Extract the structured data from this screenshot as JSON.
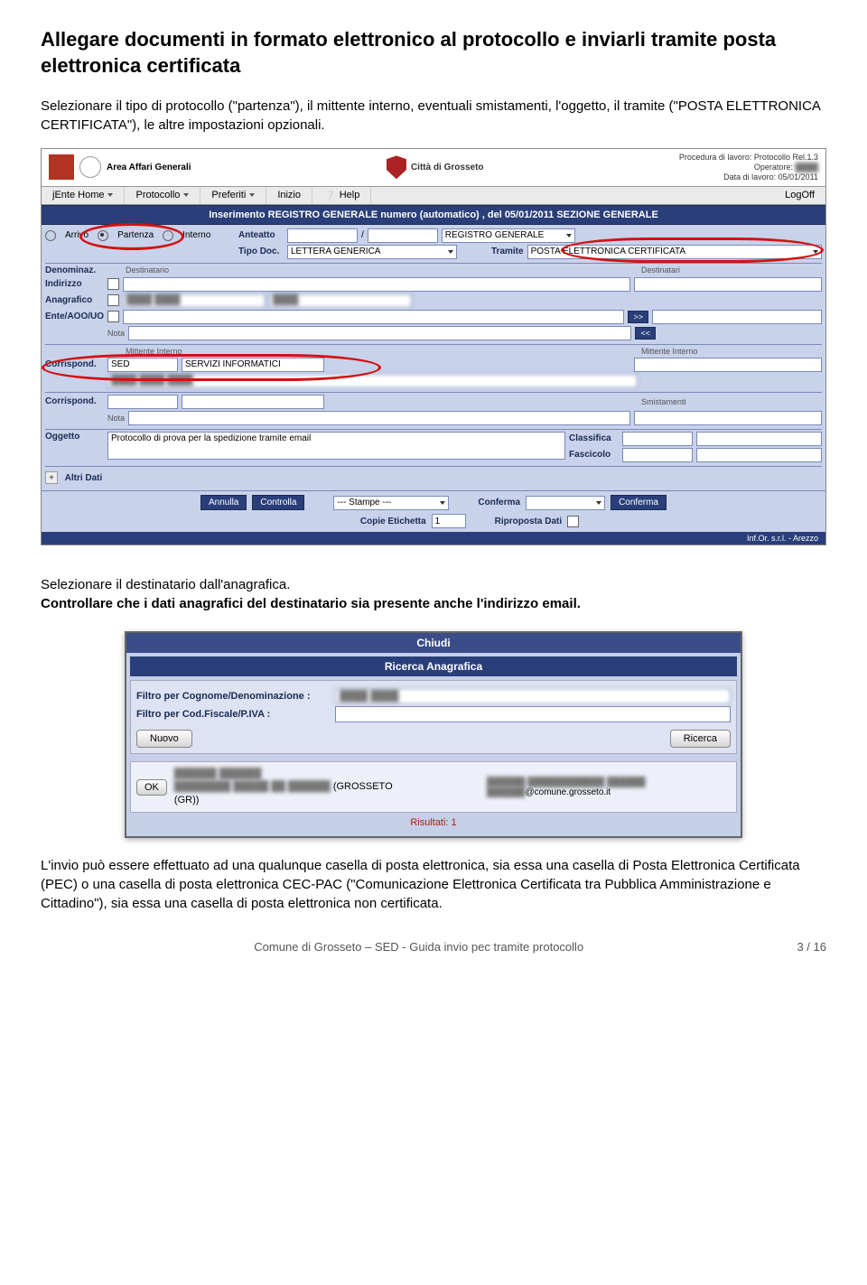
{
  "title": "Allegare documenti in formato elettronico al protocollo e inviarli tramite posta elettronica certificata",
  "para1": "Selezionare il tipo di protocollo (\"partenza\"), il mittente interno, eventuali smistamenti, l'oggetto, il tramite (\"POSTA ELETTRONICA CERTIFICATA\"), le altre impostazioni opzionali.",
  "para2a": "Selezionare il destinatario dall'anagrafica.",
  "para2b": "Controllare che  i dati anagrafici del destinatario sia presente anche l'indirizzo email.",
  "para3": "L'invio può essere effettuato ad una qualunque casella di posta elettronica, sia essa una casella di Posta Elettronica Certificata (PEC) o una casella di posta elettronica CEC-PAC (\"Comunicazione Elettronica Certificata tra Pubblica Amministrazione e Cittadino\"), sia essa una casella di posta elettronica non certificata.",
  "app": {
    "area": "Area Affari Generali",
    "city": "Città di Grosseto",
    "proc1": "Procedura di lavoro: Protocollo Rel.1.3",
    "proc2": "Operatore:",
    "proc3": "Data di lavoro: 05/01/2011"
  },
  "menu": {
    "home": "jEnte Home",
    "protocollo": "Protocollo",
    "preferiti": "Preferiti",
    "inizio": "Inizio",
    "help": "Help",
    "logoff": "LogOff"
  },
  "bluebar": "Inserimento REGISTRO GENERALE numero (automatico) , del 05/01/2011 SEZIONE GENERALE",
  "form": {
    "arrivo": "Arrivo",
    "partenza": "Partenza",
    "interno": "Interno",
    "anteatto": "Anteatto",
    "sep": "/",
    "registro": "REGISTRO GENERALE",
    "tipodoc": "Tipo Doc.",
    "tipodoc_val": "LETTERA GENERICA",
    "tramite": "Tramite",
    "tramite_val": "POSTA ELETTRONICA CERTIFICATA",
    "denominaz": "Denominaz.",
    "destinatario": "Destinatario",
    "destinatari": "Destinatari",
    "indirizzo": "Indirizzo",
    "anagrafico": "Anagrafico",
    "ente": "Ente/AOO/UO",
    "nota": "Nota",
    "mittente": "Mittente Interno",
    "corrispond": "Corrispond.",
    "sed": "SED",
    "servizi": "SERVIZI INFORMATICI",
    "smistamenti": "Smistamenti",
    "oggetto": "Oggetto",
    "oggetto_val": "Protocollo di prova per la spedizione tramite email",
    "classifica": "Classifica",
    "fascicolo": "Fascicolo",
    "altridati": "Altri Dati"
  },
  "actions": {
    "annulla": "Annulla",
    "controlla": "Controlla",
    "stampe": "--- Stampe ---",
    "copie": "Copie Etichetta",
    "copie_val": "1",
    "conferma": "Conferma",
    "riproposta": "Riproposta Dati"
  },
  "app_footer": "Inf.Or. s.r.l. - Arezzo",
  "dialog": {
    "chiudi": "Chiudi",
    "title": "Ricerca Anagrafica",
    "filtro1": "Filtro per Cognome/Denominazione :",
    "filtro2": "Filtro per Cod.Fiscale/P.IVA :",
    "nuovo": "Nuovo",
    "ricerca": "Ricerca",
    "ok": "OK",
    "grosseto": "(GROSSETO",
    "gr": "(GR))",
    "email": "@comune.grosseto.it",
    "risultati": "Risultati: 1"
  },
  "footer": {
    "left": "Comune di Grosseto – SED - Guida invio pec tramite protocollo",
    "right": "3 / 16"
  }
}
